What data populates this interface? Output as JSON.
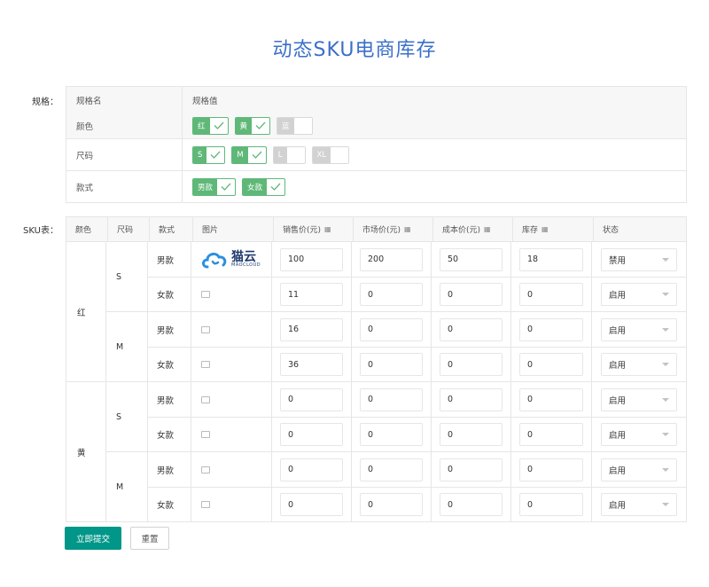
{
  "title": "动态SKU电商库存",
  "spec": {
    "label": "规格：",
    "header": {
      "name": "规格名",
      "value": "规格值"
    },
    "rows": [
      {
        "name": "颜色",
        "options": [
          {
            "label": "红",
            "checked": true
          },
          {
            "label": "黄",
            "checked": true
          },
          {
            "label": "蓝",
            "checked": false
          }
        ]
      },
      {
        "name": "尺码",
        "options": [
          {
            "label": "S",
            "checked": true
          },
          {
            "label": "M",
            "checked": true
          },
          {
            "label": "L",
            "checked": false
          },
          {
            "label": "XL",
            "checked": false
          }
        ]
      },
      {
        "name": "款式",
        "options": [
          {
            "label": "男款",
            "checked": true
          },
          {
            "label": "女款",
            "checked": true
          }
        ]
      }
    ]
  },
  "sku": {
    "label": "SKU表：",
    "headers": {
      "color": "颜色",
      "size": "尺码",
      "style": "款式",
      "image": "图片",
      "price": "销售价(元)",
      "market": "市场价(元)",
      "cost": "成本价(元)",
      "stock": "库存",
      "status": "状态"
    },
    "logo": {
      "main": "猫云",
      "sub": "MAOCLOUD"
    },
    "groups": [
      {
        "color": "红",
        "sizes": [
          {
            "size": "S",
            "rows": [
              {
                "style": "男款",
                "price": "100",
                "market": "200",
                "cost": "50",
                "stock": "18",
                "status": "禁用",
                "has_logo": true
              },
              {
                "style": "女款",
                "price": "11",
                "market": "0",
                "cost": "0",
                "stock": "0",
                "status": "启用"
              }
            ]
          },
          {
            "size": "M",
            "rows": [
              {
                "style": "男款",
                "price": "16",
                "market": "0",
                "cost": "0",
                "stock": "0",
                "status": "启用"
              },
              {
                "style": "女款",
                "price": "36",
                "market": "0",
                "cost": "0",
                "stock": "0",
                "status": "启用"
              }
            ]
          }
        ]
      },
      {
        "color": "黄",
        "sizes": [
          {
            "size": "S",
            "rows": [
              {
                "style": "男款",
                "price": "0",
                "market": "0",
                "cost": "0",
                "stock": "0",
                "status": "启用"
              },
              {
                "style": "女款",
                "price": "0",
                "market": "0",
                "cost": "0",
                "stock": "0",
                "status": "启用"
              }
            ]
          },
          {
            "size": "M",
            "rows": [
              {
                "style": "男款",
                "price": "0",
                "market": "0",
                "cost": "0",
                "stock": "0",
                "status": "启用"
              },
              {
                "style": "女款",
                "price": "0",
                "market": "0",
                "cost": "0",
                "stock": "0",
                "status": "启用"
              }
            ]
          }
        ]
      }
    ]
  },
  "buttons": {
    "submit": "立即提交",
    "reset": "重置"
  },
  "colors": {
    "title": "#3a6fc9",
    "checked": "#5fb878",
    "unchecked": "#d2d2d2",
    "submit": "#009688"
  }
}
